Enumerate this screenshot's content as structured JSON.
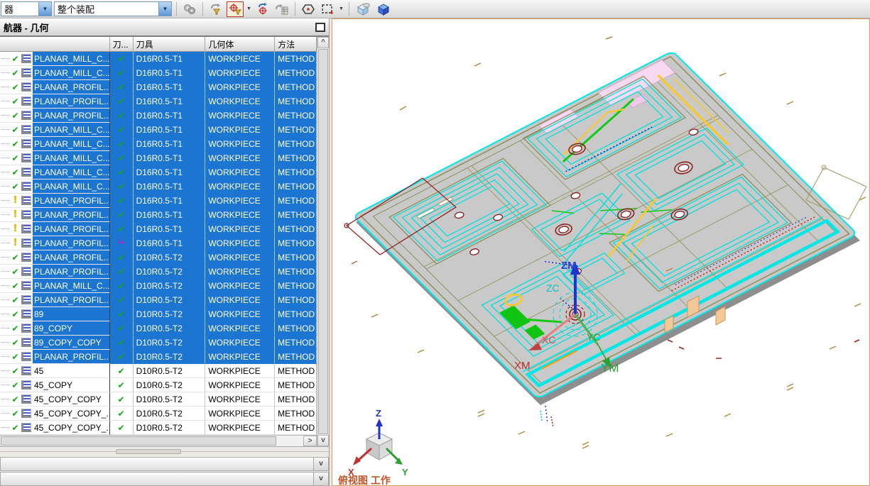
{
  "toolbar": {
    "combo1": "器",
    "combo2": "整个装配",
    "icons": [
      {
        "name": "assembly-constraints-icon",
        "active": false
      },
      {
        "name": "filter-arrow-icon",
        "active": false
      },
      {
        "name": "wcs-filter-icon",
        "active": true
      },
      {
        "name": "rotate-wcs-icon",
        "active": false
      },
      {
        "name": "layer-settings-icon",
        "active": false
      },
      {
        "name": "snap-point-icon",
        "active": false
      },
      {
        "name": "selection-marquee-icon",
        "active": false
      },
      {
        "name": "shaded-view-icon",
        "active": false
      },
      {
        "name": "wireframe-view-icon",
        "active": false
      }
    ]
  },
  "panel": {
    "title": "航器 - 几何",
    "columns": {
      "name": "",
      "path": "刀...",
      "tool": "刀具",
      "geometry": "几何体",
      "method": "方法"
    },
    "rows": [
      {
        "name": "PLANAR_MILL_C...",
        "status": "ok",
        "path": "ok",
        "tool": "D16R0.5-T1",
        "geometry": "WORKPIECE",
        "method": "METHOD",
        "selected": true
      },
      {
        "name": "PLANAR_MILL_C...",
        "status": "ok",
        "path": "ok",
        "tool": "D16R0.5-T1",
        "geometry": "WORKPIECE",
        "method": "METHOD",
        "selected": true
      },
      {
        "name": "PLANAR_PROFIL...",
        "status": "ok",
        "path": "ok",
        "tool": "D16R0.5-T1",
        "geometry": "WORKPIECE",
        "method": "METHOD",
        "selected": true
      },
      {
        "name": "PLANAR_PROFIL...",
        "status": "ok",
        "path": "ok",
        "tool": "D16R0.5-T1",
        "geometry": "WORKPIECE",
        "method": "METHOD",
        "selected": true
      },
      {
        "name": "PLANAR_PROFIL...",
        "status": "ok",
        "path": "ok",
        "tool": "D16R0.5-T1",
        "geometry": "WORKPIECE",
        "method": "METHOD",
        "selected": true
      },
      {
        "name": "PLANAR_MILL_C...",
        "status": "ok",
        "path": "ok",
        "tool": "D16R0.5-T1",
        "geometry": "WORKPIECE",
        "method": "METHOD",
        "selected": true
      },
      {
        "name": "PLANAR_MILL_C...",
        "status": "ok",
        "path": "ok",
        "tool": "D16R0.5-T1",
        "geometry": "WORKPIECE",
        "method": "METHOD",
        "selected": true
      },
      {
        "name": "PLANAR_MILL_C...",
        "status": "ok",
        "path": "ok",
        "tool": "D16R0.5-T1",
        "geometry": "WORKPIECE",
        "method": "METHOD",
        "selected": true
      },
      {
        "name": "PLANAR_MILL_C...",
        "status": "ok",
        "path": "ok",
        "tool": "D16R0.5-T1",
        "geometry": "WORKPIECE",
        "method": "METHOD",
        "selected": true
      },
      {
        "name": "PLANAR_MILL_C...",
        "status": "ok",
        "path": "ok",
        "tool": "D16R0.5-T1",
        "geometry": "WORKPIECE",
        "method": "METHOD",
        "selected": true
      },
      {
        "name": "PLANAR_PROFIL...",
        "status": "warn",
        "path": "ok",
        "tool": "D16R0.5-T1",
        "geometry": "WORKPIECE",
        "method": "METHOD",
        "selected": true
      },
      {
        "name": "PLANAR_PROFIL...",
        "status": "warn",
        "path": "ok",
        "tool": "D16R0.5-T1",
        "geometry": "WORKPIECE",
        "method": "METHOD",
        "selected": true
      },
      {
        "name": "PLANAR_PROFIL...",
        "status": "warn",
        "path": "ok",
        "tool": "D16R0.5-T1",
        "geometry": "WORKPIECE",
        "method": "METHOD",
        "selected": true
      },
      {
        "name": "PLANAR_PROFIL...",
        "status": "warn",
        "path": "redo",
        "tool": "D16R0.5-T1",
        "geometry": "WORKPIECE",
        "method": "METHOD",
        "selected": true
      },
      {
        "name": "PLANAR_PROFIL...",
        "status": "ok",
        "path": "ok",
        "tool": "D10R0.5-T2",
        "geometry": "WORKPIECE",
        "method": "METHOD",
        "selected": true
      },
      {
        "name": "PLANAR_PROFIL...",
        "status": "ok",
        "path": "ok",
        "tool": "D10R0.5-T2",
        "geometry": "WORKPIECE",
        "method": "METHOD",
        "selected": true
      },
      {
        "name": "PLANAR_MILL_C...",
        "status": "ok",
        "path": "ok",
        "tool": "D10R0.5-T2",
        "geometry": "WORKPIECE",
        "method": "METHOD",
        "selected": true
      },
      {
        "name": "PLANAR_PROFIL...",
        "status": "ok",
        "path": "ok",
        "tool": "D10R0.5-T2",
        "geometry": "WORKPIECE",
        "method": "METHOD",
        "selected": true
      },
      {
        "name": "89",
        "status": "ok",
        "path": "ok",
        "tool": "D10R0.5-T2",
        "geometry": "WORKPIECE",
        "method": "METHOD",
        "selected": true
      },
      {
        "name": "89_COPY",
        "status": "ok",
        "path": "ok",
        "tool": "D10R0.5-T2",
        "geometry": "WORKPIECE",
        "method": "METHOD",
        "selected": true
      },
      {
        "name": "89_COPY_COPY",
        "status": "ok",
        "path": "ok",
        "tool": "D10R0.5-T2",
        "geometry": "WORKPIECE",
        "method": "METHOD",
        "selected": true
      },
      {
        "name": "PLANAR_PROFIL...",
        "status": "ok",
        "path": "ok",
        "tool": "D10R0.5-T2",
        "geometry": "WORKPIECE",
        "method": "METHOD",
        "selected": true
      },
      {
        "name": "45",
        "status": "ok",
        "path": "ok",
        "tool": "D10R0.5-T2",
        "geometry": "WORKPIECE",
        "method": "METHOD",
        "selected": false
      },
      {
        "name": "45_COPY",
        "status": "ok",
        "path": "ok",
        "tool": "D10R0.5-T2",
        "geometry": "WORKPIECE",
        "method": "METHOD",
        "selected": false
      },
      {
        "name": "45_COPY_COPY",
        "status": "ok",
        "path": "ok",
        "tool": "D10R0.5-T2",
        "geometry": "WORKPIECE",
        "method": "METHOD",
        "selected": false
      },
      {
        "name": "45_COPY_COPY_...",
        "status": "ok",
        "path": "ok",
        "tool": "D10R0.5-T2",
        "geometry": "WORKPIECE",
        "method": "METHOD",
        "selected": false
      },
      {
        "name": "45_COPY_COPY_...",
        "status": "ok",
        "path": "ok",
        "tool": "D10R0.5-T2",
        "geometry": "WORKPIECE",
        "method": "METHOD",
        "selected": false
      }
    ]
  },
  "scrollbar": {
    "up": "^",
    "down": "v",
    "right": ">",
    "collapse": "v"
  },
  "icon_glyphs": {
    "ok": "✔",
    "warn": "!",
    "redo": "↪",
    "dropdown": "▼"
  },
  "viewport": {
    "wcs": {
      "zm": "ZM",
      "zc": "ZC",
      "xc": "XC",
      "xm": "XM",
      "yc": "YC",
      "ym": "YM"
    },
    "triad": {
      "x": "X",
      "y": "Y",
      "z": "Z"
    },
    "status_text": "俯视图 工作"
  },
  "colors": {
    "selection": "#1B75D1",
    "check_green": "#17A517",
    "warn_yellow": "#F2C200",
    "redo_purple": "#9B30C8",
    "toolpath_cyan": "#00E8E8",
    "edge_olive": "#8F8F5A",
    "contour_red": "#8B1A1A",
    "accent_green": "#14C814",
    "accent_yellow": "#FFC820",
    "plate_gray": "#C9C9C9",
    "viewport_border": "#E39A55",
    "status_text": "#C1562B"
  }
}
